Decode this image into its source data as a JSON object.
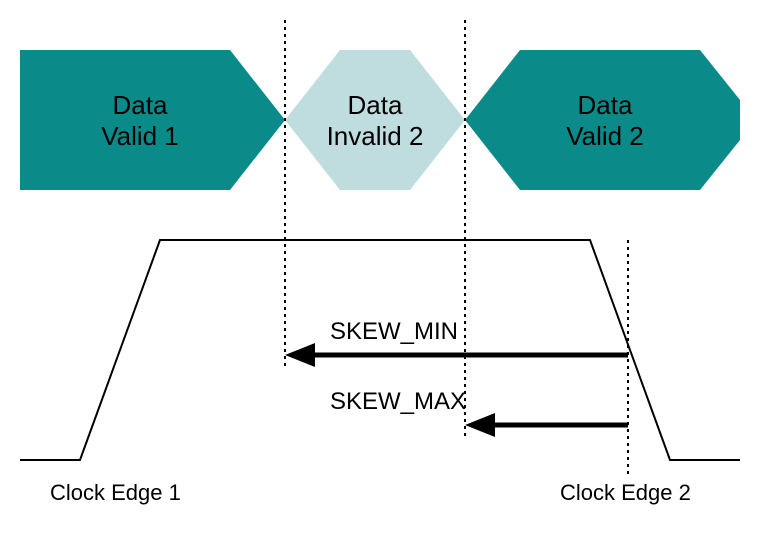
{
  "data_blocks": {
    "valid1_line1": "Data",
    "valid1_line2": "Valid 1",
    "invalid2_line1": "Data",
    "invalid2_line2": "Invalid 2",
    "valid2_line1": "Data",
    "valid2_line2": "Valid 2"
  },
  "skew": {
    "min_label": "SKEW_MIN",
    "max_label": "SKEW_MAX"
  },
  "clock": {
    "edge1": "Clock Edge 1",
    "edge2": "Clock Edge 2"
  },
  "colors": {
    "valid_fill": "#0b8a8a",
    "invalid_fill": "#bfddde",
    "stroke": "#000"
  }
}
